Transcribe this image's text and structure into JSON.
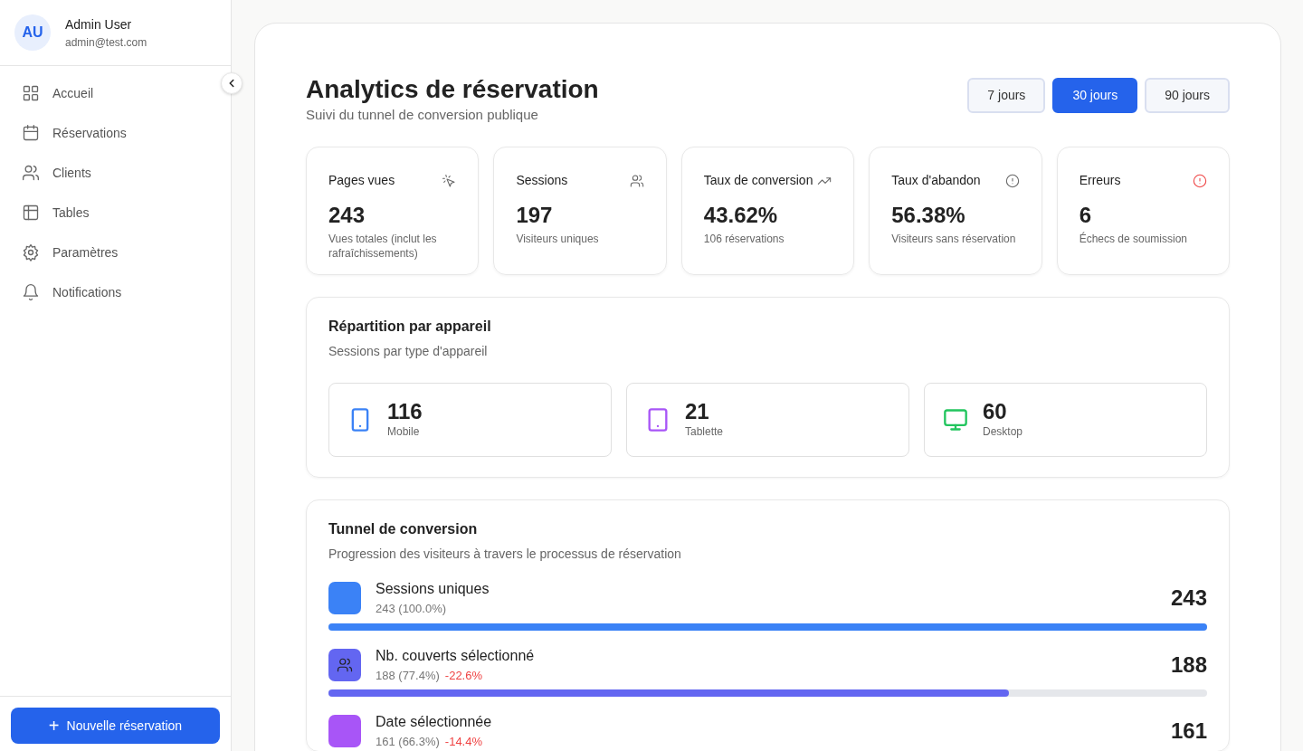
{
  "user": {
    "initials": "AU",
    "name": "Admin User",
    "email": "admin@test.com"
  },
  "sidebar": {
    "items": [
      {
        "label": "Accueil",
        "kind": "grid",
        "selected": false
      },
      {
        "label": "Réservations",
        "kind": "calendar",
        "selected": false
      },
      {
        "label": "Clients",
        "kind": "users",
        "selected": false
      },
      {
        "label": "Tables",
        "kind": "table",
        "selected": false
      },
      {
        "label": "Paramètres",
        "kind": "gear",
        "selected": false
      },
      {
        "label": "Notifications",
        "kind": "bell",
        "selected": false
      }
    ],
    "new_button": {
      "icon": "+",
      "label": "Nouvelle réservation"
    }
  },
  "header": {
    "title": "Analytics de réservation",
    "subtitle": "Suivi du tunnel de conversion publique"
  },
  "periods": [
    {
      "label": "7 jours",
      "selected": false
    },
    {
      "label": "30 jours",
      "selected": true
    },
    {
      "label": "90 jours",
      "selected": false
    }
  ],
  "kpis": [
    {
      "label": "Pages vues",
      "kind": "pointer",
      "value": "243",
      "note": "Vues totales (inclut les rafraîchissements)"
    },
    {
      "label": "Sessions",
      "kind": "users",
      "value": "197",
      "note": "Visiteurs uniques"
    },
    {
      "label": "Taux de conversion",
      "kind": "trend",
      "value": "43.62%",
      "note": "106 réservations"
    },
    {
      "label": "Taux d'abandon",
      "kind": "info",
      "value": "56.38%",
      "note": "Visiteurs sans réservation"
    },
    {
      "label": "Erreurs",
      "kind": "error",
      "value": "6",
      "note": "Échecs de soumission"
    }
  ],
  "devices": {
    "title": "Répartition par appareil",
    "subtitle": "Sessions par type d'appareil",
    "items": [
      {
        "kind": "mobile",
        "color": "#3b82f6",
        "value": "116",
        "label": "Mobile"
      },
      {
        "kind": "tablet",
        "color": "#a855f7",
        "value": "21",
        "label": "Tablette"
      },
      {
        "kind": "desktop",
        "color": "#22c55e",
        "value": "60",
        "label": "Desktop"
      }
    ]
  },
  "funnel": {
    "title": "Tunnel de conversion",
    "subtitle": "Progression des visiteurs à travers le processus de réservation",
    "steps": [
      {
        "kind": "plain",
        "color": "#3b82f6",
        "label": "Sessions uniques",
        "detail": "243 (100.0%)",
        "value": "243",
        "level": 1.0
      },
      {
        "kind": "users",
        "color": "#6366f1",
        "label": "Nb. couverts sélectionné",
        "detail": "188 (77.4%)",
        "drop": "-22.6%",
        "value": "188",
        "level": 0.774
      },
      {
        "kind": "plain",
        "color": "#a855f7",
        "label": "Date sélectionnée",
        "detail": "161 (66.3%)",
        "drop": "-14.4%",
        "value": "161"
      }
    ]
  }
}
